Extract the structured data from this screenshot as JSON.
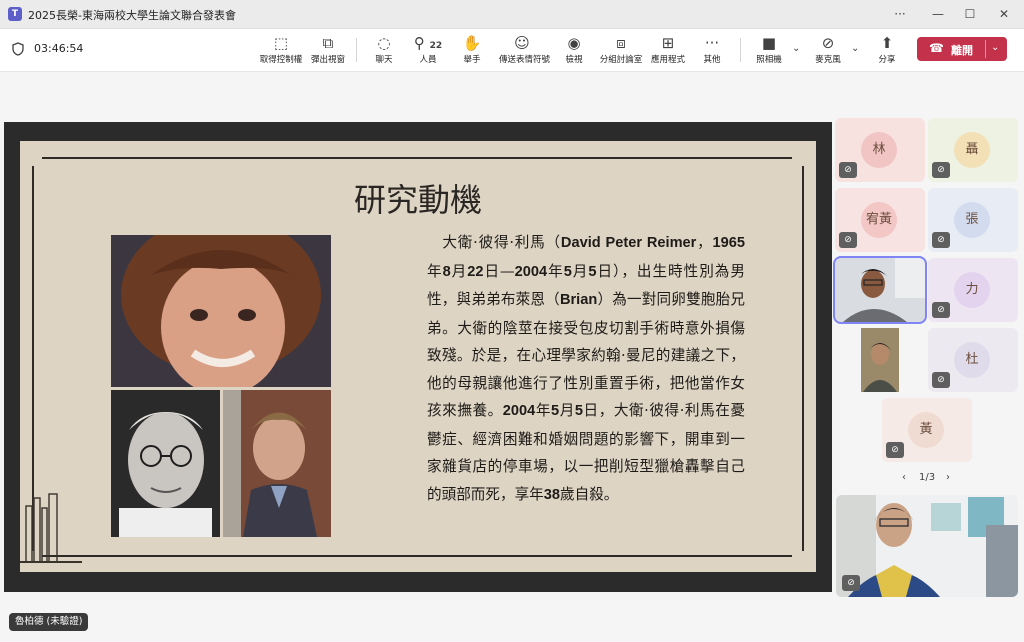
{
  "window": {
    "app_icon": "teams-icon",
    "title": "2025長榮-東海兩校大學生論文聯合發表會",
    "more": "···",
    "minimize": "—",
    "maximize": "☐",
    "close": "✕"
  },
  "toolbar": {
    "timer": "03:46:54",
    "items": [
      {
        "label": "取得控制權",
        "icon": "take-control-icon",
        "glyph": "⬚"
      },
      {
        "label": "彈出視窗",
        "icon": "popout-icon",
        "glyph": "⧉"
      },
      {
        "label": "聊天",
        "icon": "chat-icon",
        "glyph": "◌"
      },
      {
        "label": "人員",
        "icon": "people-icon",
        "glyph": "⚲",
        "count": "22"
      },
      {
        "label": "舉手",
        "icon": "raise-hand-icon",
        "glyph": "✋"
      },
      {
        "label": "傳送表情符號",
        "icon": "emoji-icon",
        "glyph": "☺"
      },
      {
        "label": "檢視",
        "icon": "view-icon",
        "glyph": "◉"
      },
      {
        "label": "分組討論室",
        "icon": "breakout-rooms-icon",
        "glyph": "⧈"
      },
      {
        "label": "應用程式",
        "icon": "apps-icon",
        "glyph": "⊞"
      },
      {
        "label": "其他",
        "icon": "more-icon",
        "glyph": "···"
      },
      {
        "label": "照相機",
        "icon": "camera-icon",
        "glyph": "■"
      },
      {
        "label": "麥克風",
        "icon": "mic-off-icon",
        "glyph": "⊘"
      },
      {
        "label": "分享",
        "icon": "share-icon",
        "glyph": "⬆"
      }
    ],
    "leave_label": "離開"
  },
  "slide": {
    "title": "研究動機",
    "body": [
      {
        "t": "　大衛·彼得·利馬（",
        "b": false
      },
      {
        "t": "David Peter Reimer",
        "b": true
      },
      {
        "t": "，",
        "b": false
      },
      {
        "t": "1965",
        "b": true
      },
      {
        "t": "年",
        "b": false
      },
      {
        "t": "8",
        "b": true
      },
      {
        "t": "月",
        "b": false
      },
      {
        "t": "22",
        "b": true
      },
      {
        "t": "日—",
        "b": false
      },
      {
        "t": "2004",
        "b": true
      },
      {
        "t": "年",
        "b": false
      },
      {
        "t": "5",
        "b": true
      },
      {
        "t": "月",
        "b": false
      },
      {
        "t": "5",
        "b": true
      },
      {
        "t": "日），出生時性別為男性，與弟弟布萊恩（",
        "b": false
      },
      {
        "t": "Brian",
        "b": true
      },
      {
        "t": "）為一對同卵雙胞胎兄弟。大衛的陰莖在接受包皮切割手術時意外損傷致殘。於是，在心理學家約翰·曼尼的建議之下，他的母親讓他進行了性別重置手術，把他當作女孩來撫養。",
        "b": false
      },
      {
        "t": "2004",
        "b": true
      },
      {
        "t": "年",
        "b": false
      },
      {
        "t": "5",
        "b": true
      },
      {
        "t": "月",
        "b": false
      },
      {
        "t": "5",
        "b": true
      },
      {
        "t": "日，大衛·彼得·利馬在憂鬱症、經濟困難和婚姻問題的影響下，開車到一家雜貨店的停車場，以一把削短型獵槍轟擊自己的頭部而死，享年",
        "b": false
      },
      {
        "t": "38",
        "b": true
      },
      {
        "t": "歲自殺。",
        "b": false
      }
    ]
  },
  "participants": [
    {
      "initial": "林",
      "bg": "#f7e2e0",
      "avatar": "#f0c5c4"
    },
    {
      "initial": "聶",
      "bg": "#eef2e2",
      "avatar": "#f3e0b6"
    },
    {
      "initial": "宥黃",
      "bg": "#f6e3e2",
      "avatar": "#f3c7c6"
    },
    {
      "initial": "張",
      "bg": "#e8edf5",
      "avatar": "#d3dbee"
    },
    {
      "initial": "力",
      "bg": "#eee5f2",
      "avatar": "#e4d3ee"
    },
    {
      "initial": "杜",
      "bg": "#ece9f1",
      "avatar": "#e0dbea"
    },
    {
      "initial": "黃",
      "bg": "#f5eae6",
      "avatar": "#f0dbd3"
    }
  ],
  "pager": {
    "prev": "‹",
    "label": "1/3",
    "next": "›"
  },
  "self_name": "魯柏德 (未驗證)"
}
